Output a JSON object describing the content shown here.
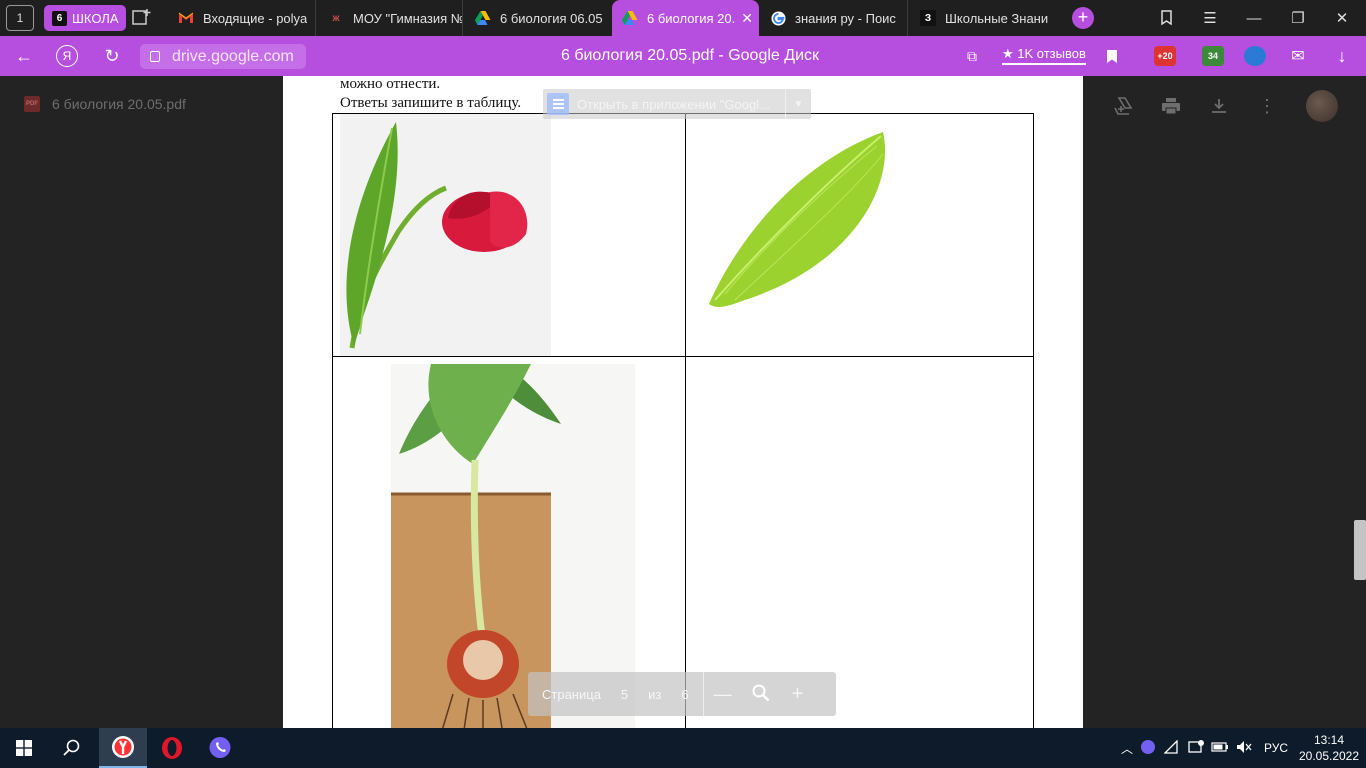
{
  "tabbar": {
    "home_badge": "1",
    "group": {
      "badge": "6",
      "label": "ШКОЛА"
    },
    "tabs": [
      {
        "title": "Входящие - polya",
        "icon": "gmail-icon"
      },
      {
        "title": "МОУ \"Гимназия №",
        "icon": "school-crest-icon"
      },
      {
        "title": "6 биология 06.05",
        "icon": "google-drive-icon"
      },
      {
        "title": "6 биология 20.",
        "icon": "google-drive-icon",
        "active": true
      },
      {
        "title": "знания ру - Поис",
        "icon": "google-icon"
      },
      {
        "title": "Школьные Знани",
        "icon": "znanija-icon"
      }
    ],
    "znanija_badge": "З"
  },
  "addressbar": {
    "url": "drive.google.com",
    "page_title": "6 биология 20.05.pdf - Google Диск",
    "reviews": "★ 1K отзывов",
    "ext_badges": {
      "mail": "+20",
      "counter": "34"
    }
  },
  "viewer": {
    "file_name": "6 биология 20.05.pdf",
    "pdf_badge": "PDF",
    "doc_line1": "можно отнести.",
    "doc_line2": "Ответы запишите в таблицу.",
    "open_in_app": "Открыть в приложении \"Googl...",
    "pager": {
      "label": "Страница",
      "current": "5",
      "of": "из",
      "total": "6"
    }
  },
  "taskbar": {
    "lang": "РУС",
    "time": "13:14",
    "date": "20.05.2022"
  },
  "colors": {
    "accent": "#b64ee0",
    "viewer_bg": "#232323",
    "taskbar": "#0d1b2a"
  }
}
